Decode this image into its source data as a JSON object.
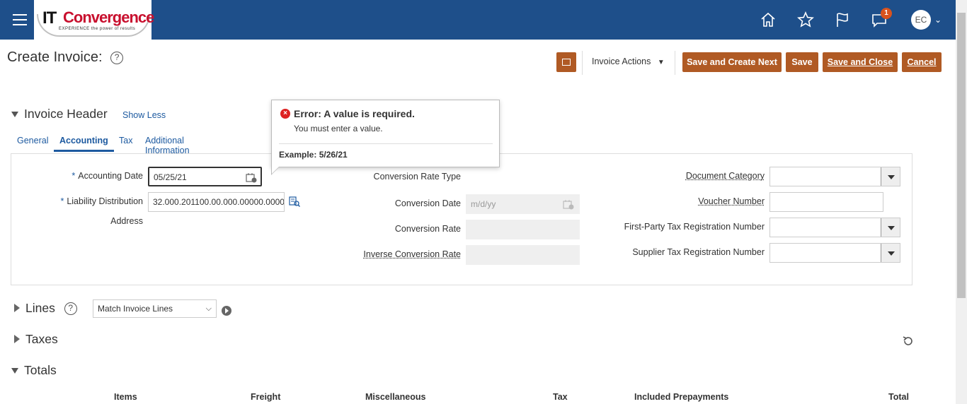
{
  "header": {
    "logo_it": "IT",
    "logo_convergence": "Convergence",
    "logo_tagline": "EXPERIENCE the power of results",
    "notification_count": "1",
    "user_initials": "EC"
  },
  "page": {
    "title": "Create Invoice:",
    "help": "?"
  },
  "toolbar": {
    "invoice_actions": "Invoice Actions",
    "save_and_create_next": "Save and Create Next",
    "save": "Save",
    "save_and_close": "Save and Close",
    "cancel": "Cancel"
  },
  "invoice_header": {
    "title": "Invoice Header",
    "show_less": "Show Less",
    "tabs": [
      "General",
      "Accounting",
      "Tax",
      "Additional Information"
    ],
    "active_tab": "Accounting"
  },
  "accounting": {
    "accounting_date_label": "Accounting Date",
    "accounting_date_value": "05/25/21",
    "liability_label": "Liability Distribution",
    "liability_value": "32.000.201100.00.000.00000.0000",
    "address_label": "Address",
    "conversion_rate_type_label": "Conversion Rate Type",
    "conversion_date_label": "Conversion Date",
    "conversion_date_placeholder": "m/d/yy",
    "conversion_rate_label": "Conversion Rate",
    "inverse_conversion_rate_label": "Inverse Conversion Rate",
    "document_category_label": "Document Category",
    "voucher_number_label": "Voucher Number",
    "first_party_tax_label": "First-Party Tax Registration Number",
    "supplier_tax_label": "Supplier Tax Registration Number"
  },
  "error_popup": {
    "title": "Error: A value is required.",
    "message": "You must enter a value.",
    "example": "Example: 5/26/21"
  },
  "lines": {
    "title": "Lines",
    "help": "?",
    "select_value": "Match Invoice Lines"
  },
  "taxes": {
    "title": "Taxes"
  },
  "totals": {
    "title": "Totals",
    "headers": [
      "Items",
      "Freight",
      "Miscellaneous",
      "Tax",
      "Included Prepayments",
      "Total"
    ]
  },
  "colors": {
    "topbar": "#1e4f8a",
    "button": "#b05a24",
    "link": "#1d5aa0",
    "error": "#dd2222"
  }
}
